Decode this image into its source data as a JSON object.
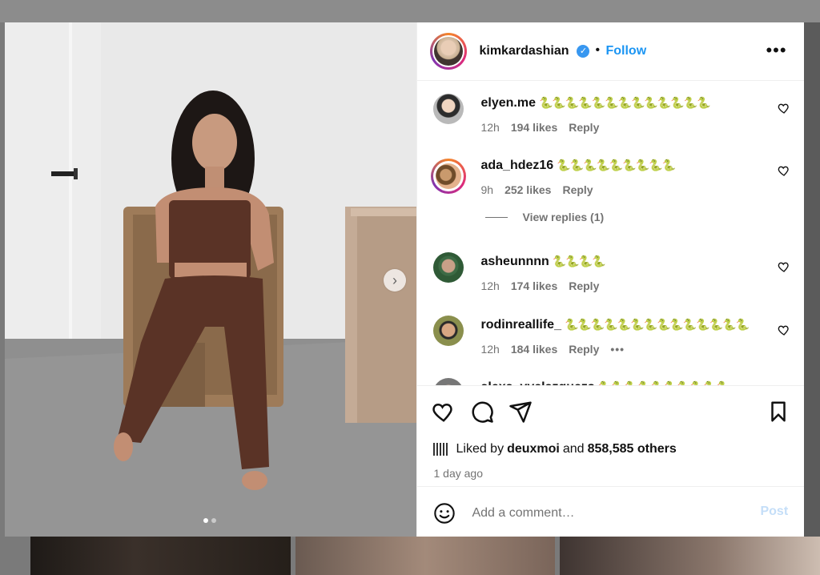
{
  "post": {
    "username": "kimkardashian",
    "verified_mark": "✓",
    "separator": "•",
    "follow_label": "Follow",
    "more_label": "•••",
    "next_label": "›",
    "carousel": {
      "total": 2,
      "current": 1
    }
  },
  "comments": [
    {
      "user": "elyen.me",
      "text": "🐍🐍🐍🐍🐍🐍🐍🐍🐍🐍🐍🐍🐍",
      "time": "12h",
      "likes": "194 likes",
      "reply": "Reply",
      "avatar_icon": "avatar-elyen"
    },
    {
      "user": "ada_hdez16",
      "text": "🐍🐍🐍🐍🐍🐍🐍🐍🐍",
      "time": "9h",
      "likes": "252 likes",
      "reply": "Reply",
      "avatar_icon": "avatar-ada"
    },
    {
      "user": "asheunnnn",
      "text": "🐍🐍🐍🐍",
      "time": "12h",
      "likes": "174 likes",
      "reply": "Reply",
      "avatar_icon": "avatar-asheunnnn"
    },
    {
      "user": "rodinreallife_",
      "text": "🐍🐍🐍🐍🐍🐍🐍🐍🐍🐍🐍🐍🐍🐍",
      "time": "12h",
      "likes": "184 likes",
      "reply": "Reply",
      "more": "•••",
      "avatar_icon": "avatar-rodin"
    },
    {
      "user": "alexa_vvelazquezs",
      "text": "🐍🐍🐍🐍🐍🐍🐍🐍🐍🐍",
      "avatar_icon": "avatar-alexa"
    }
  ],
  "view_replies_label": "View replies (1)",
  "likes": {
    "prefix": "Liked by",
    "user": "deuxmoi",
    "conjunction": "and",
    "count": "858,585 others"
  },
  "posted_time": "1 day ago",
  "add_comment": {
    "placeholder": "Add a comment…",
    "post_label": "Post"
  },
  "icons": {
    "like": "heart-icon",
    "comment": "comment-icon",
    "share": "send-icon",
    "save": "bookmark-icon",
    "emoji": "smiley-icon",
    "verified": "verified-badge-icon"
  },
  "colors": {
    "accent": "#1b95f3",
    "post_disabled": "#c4def8",
    "muted": "#737373"
  }
}
